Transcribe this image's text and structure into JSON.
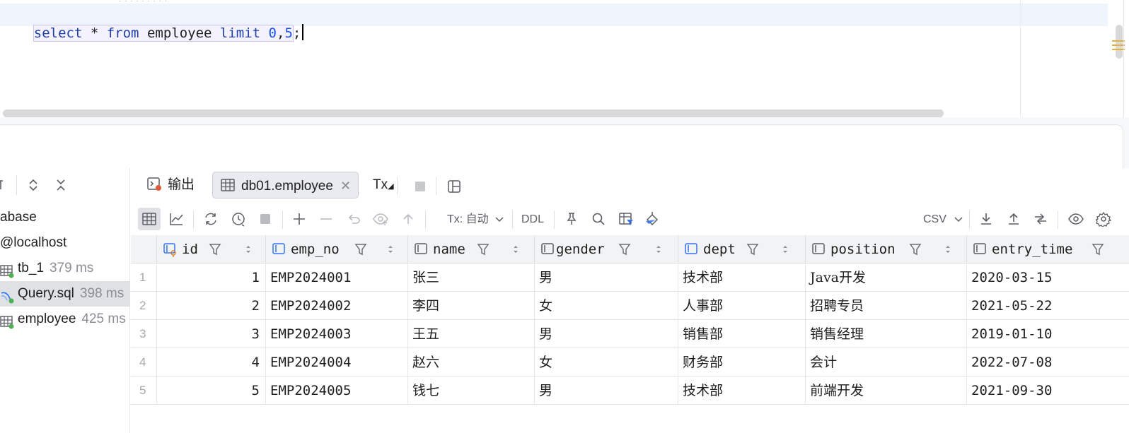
{
  "editor": {
    "tokens": [
      {
        "text": "select",
        "kind": "kw"
      },
      {
        "text": " * ",
        "kind": "plain"
      },
      {
        "text": "from",
        "kind": "kw"
      },
      {
        "text": " employee ",
        "kind": "plain"
      },
      {
        "text": "limit",
        "kind": "kw"
      },
      {
        "text": " ",
        "kind": "plain"
      },
      {
        "text": "0",
        "kind": "num"
      },
      {
        "text": ",",
        "kind": "plain"
      },
      {
        "text": "5",
        "kind": "num"
      },
      {
        "text": ";",
        "kind": "plain"
      }
    ]
  },
  "services": {
    "items": [
      {
        "label": "abase",
        "time": ""
      },
      {
        "label": "@localhost",
        "time": ""
      },
      {
        "label": "tb_1",
        "time": "379 ms"
      },
      {
        "label": "Query.sql",
        "time": "398 ms"
      },
      {
        "label": "employee",
        "time": "425 ms"
      }
    ]
  },
  "tabs": {
    "output": "输出",
    "result": "db01.employee",
    "tx": "Tx"
  },
  "toolbar": {
    "tx_mode": "Tx: 自动",
    "ddl": "DDL",
    "export_format": "CSV"
  },
  "grid": {
    "columns": [
      "id",
      "emp_no",
      "name",
      "gender",
      "dept",
      "position",
      "entry_time"
    ],
    "rows": [
      {
        "n": "1",
        "id": "1",
        "emp_no": "EMP2024001",
        "name": "张三",
        "gender": "男",
        "dept": "技术部",
        "position": "Java开发",
        "entry_time": "2020-03-15"
      },
      {
        "n": "2",
        "id": "2",
        "emp_no": "EMP2024002",
        "name": "李四",
        "gender": "女",
        "dept": "人事部",
        "position": "招聘专员",
        "entry_time": "2021-05-22"
      },
      {
        "n": "3",
        "id": "3",
        "emp_no": "EMP2024003",
        "name": "王五",
        "gender": "男",
        "dept": "销售部",
        "position": "销售经理",
        "entry_time": "2019-01-10"
      },
      {
        "n": "4",
        "id": "4",
        "emp_no": "EMP2024004",
        "name": "赵六",
        "gender": "女",
        "dept": "财务部",
        "position": "会计",
        "entry_time": "2022-07-08"
      },
      {
        "n": "5",
        "id": "5",
        "emp_no": "EMP2024005",
        "name": "钱七",
        "gender": "男",
        "dept": "技术部",
        "position": "前端开发",
        "entry_time": "2021-09-30"
      }
    ]
  },
  "colors": {
    "accent": "#3574f0",
    "ok": "#4caf50",
    "keyword": "#1f3fa8",
    "number": "#1750eb"
  }
}
